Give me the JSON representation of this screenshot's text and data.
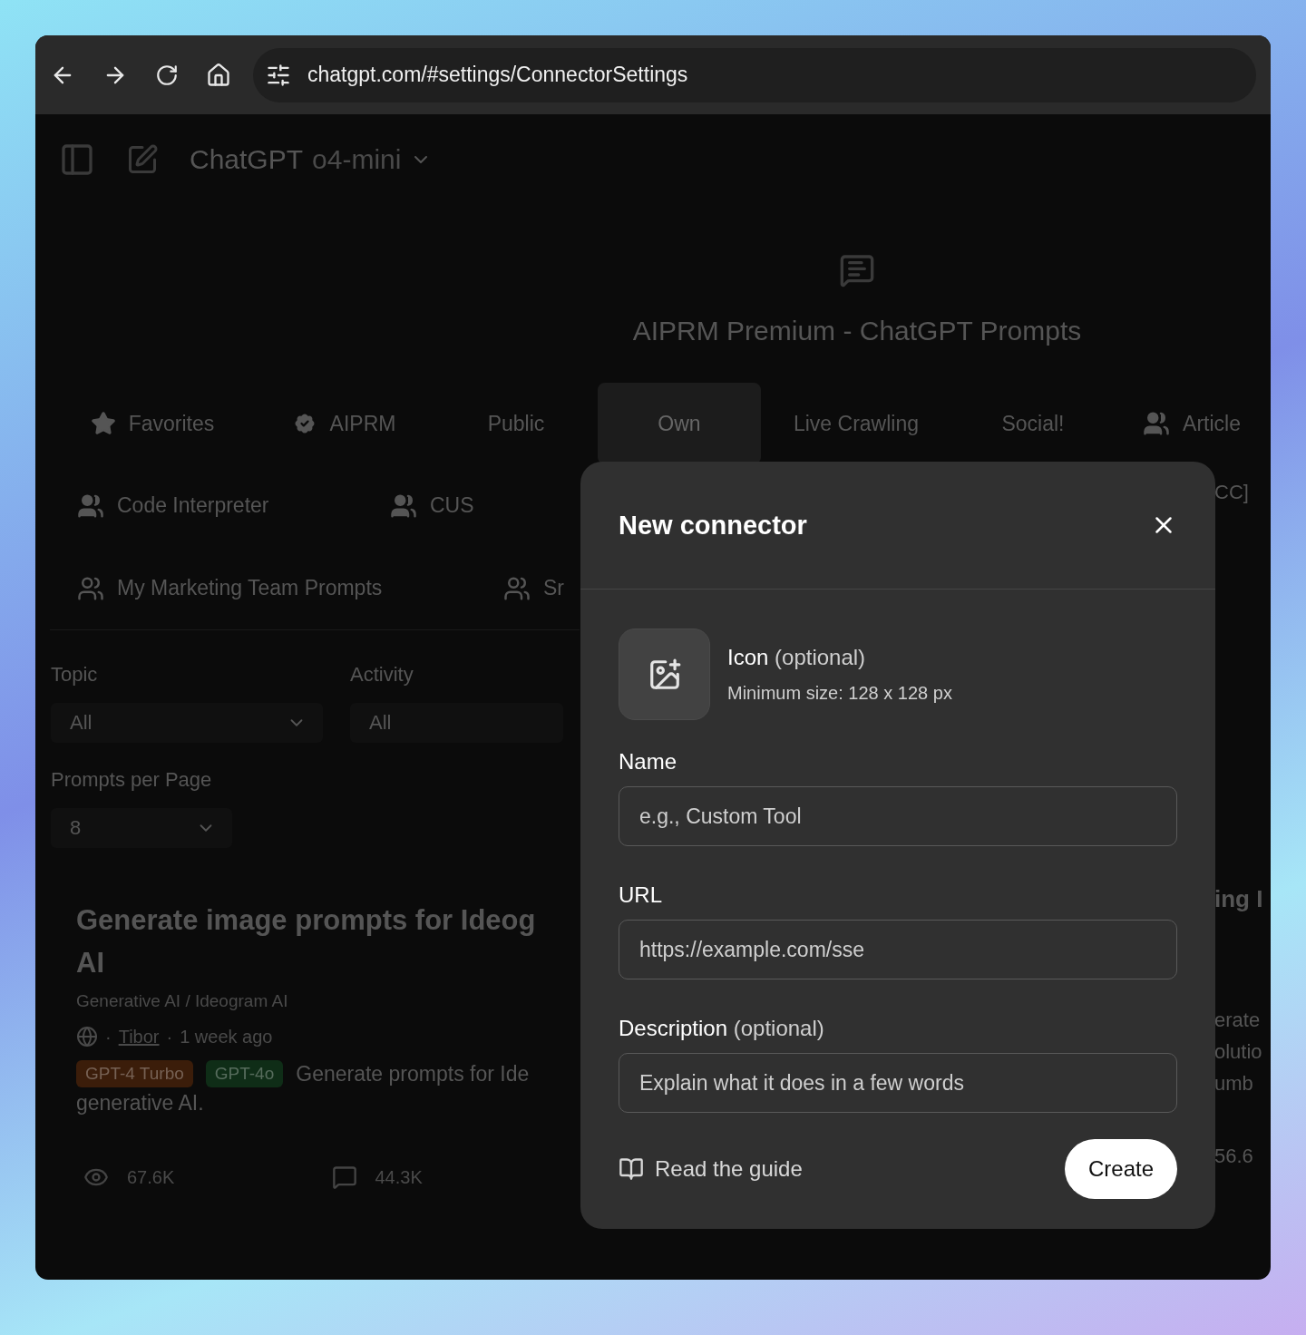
{
  "browser": {
    "url": "chatgpt.com/#settings/ConnectorSettings"
  },
  "header": {
    "model_name": "ChatGPT",
    "model_version": "o4-mini"
  },
  "hero": {
    "title": "AIPRM Premium - ChatGPT Prompts"
  },
  "tabs_top": [
    {
      "label": "Favorites",
      "kind": "favorite",
      "selected": false
    },
    {
      "label": "AIPRM",
      "kind": "verified",
      "selected": false
    },
    {
      "label": "Public",
      "kind": "plain",
      "selected": false
    },
    {
      "label": "Own",
      "kind": "plain",
      "selected": true
    },
    {
      "label": "Live Crawling",
      "kind": "plain",
      "selected": false
    },
    {
      "label": "Social!",
      "kind": "plain",
      "selected": false
    },
    {
      "label": "Article",
      "kind": "team",
      "selected": false
    }
  ],
  "tabs_left": [
    [
      {
        "label": "Code Interpreter",
        "kind": "team"
      },
      {
        "label": "CUS",
        "kind": "team"
      }
    ],
    [
      {
        "label": "My Marketing Team Prompts",
        "kind": "shared"
      },
      {
        "label": "Sr",
        "kind": "shared"
      }
    ]
  ],
  "filters": [
    {
      "label": "Topic",
      "value": "All",
      "chevron": true
    },
    {
      "label": "Activity",
      "value": "All",
      "chevron": false
    },
    {
      "label": "Prompts per Page",
      "value": "8",
      "chevron": true
    }
  ],
  "card": {
    "title_lines": [
      "Generate image prompts for Ideog",
      "AI"
    ],
    "category": "Generative AI / Ideogram AI",
    "separator": "·",
    "author": "Tibor",
    "time": "1 week ago",
    "tags": [
      {
        "label": "GPT-4 Turbo",
        "color": "#3b1d0a"
      },
      {
        "label": "GPT-4o",
        "color": "#0f2d17"
      }
    ],
    "description_lines": [
      "Generate prompts for Ide",
      "generative AI."
    ],
    "stats": [
      {
        "kind": "views",
        "value": "67.6K"
      },
      {
        "kind": "comments",
        "value": "44.3K"
      }
    ]
  },
  "right_edge": [
    {
      "kind": "tab",
      "text": "CC]"
    },
    {
      "kind": "title",
      "text": "ing I"
    },
    {
      "kind": "text",
      "text": "erate"
    },
    {
      "kind": "text",
      "text": "olutio"
    },
    {
      "kind": "text",
      "text": "umb"
    },
    {
      "kind": "stat",
      "text": "56.6"
    }
  ],
  "modal": {
    "title": "New connector",
    "icon_label": "Icon",
    "icon_hint": "(optional)",
    "icon_note": "Minimum size: 128 x 128 px",
    "fields": [
      {
        "label": "Name",
        "placeholder": "e.g., Custom Tool"
      },
      {
        "label": "URL",
        "placeholder": "https://example.com/sse"
      },
      {
        "label": "Description",
        "hint": "(optional)",
        "placeholder": "Explain what it does in a few words"
      }
    ],
    "guide_link": "Read the guide",
    "submit": "Create"
  }
}
